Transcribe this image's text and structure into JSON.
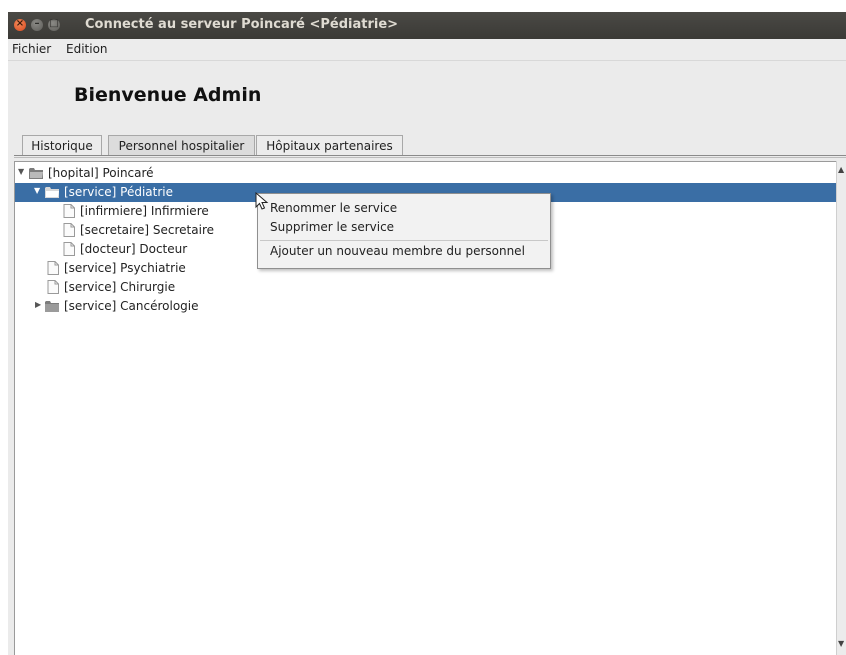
{
  "window": {
    "title": "Connecté au serveur Poincaré <Pédiatrie>",
    "buttons": [
      "close-icon",
      "minimize-icon",
      "maximize-icon"
    ]
  },
  "menubar": {
    "fichier": "Fichier",
    "edition": "Edition"
  },
  "welcome": "Bienvenue Admin",
  "tabs": [
    {
      "label": "Historique",
      "active": false
    },
    {
      "label": "Personnel hospitalier",
      "active": true
    },
    {
      "label": "Hôpitaux partenaires",
      "active": false
    }
  ],
  "tree": [
    {
      "label": "[hopital] Poincaré",
      "type": "folder",
      "expanded": true,
      "selected": false
    },
    {
      "label": "[service] Pédiatrie",
      "type": "folder",
      "expanded": true,
      "selected": true
    },
    {
      "label": "[infirmiere] Infirmiere",
      "type": "leaf",
      "selected": false
    },
    {
      "label": "[secretaire] Secretaire",
      "type": "leaf",
      "selected": false
    },
    {
      "label": "[docteur] Docteur",
      "type": "leaf",
      "selected": false
    },
    {
      "label": "[service] Psychiatrie",
      "type": "leaf",
      "selected": false
    },
    {
      "label": "[service] Chirurgie",
      "type": "leaf",
      "selected": false
    },
    {
      "label": "[service] Cancérologie",
      "type": "folder",
      "expanded": false,
      "selected": false
    }
  ],
  "context_menu": {
    "rename": "Renommer le service",
    "delete": "Supprimer le service",
    "add_member": "Ajouter un nouveau membre du personnel"
  },
  "colors": {
    "titlebar": "#3f3e3a",
    "selection": "#3a6ea5",
    "close_button": "#e05a2b"
  }
}
